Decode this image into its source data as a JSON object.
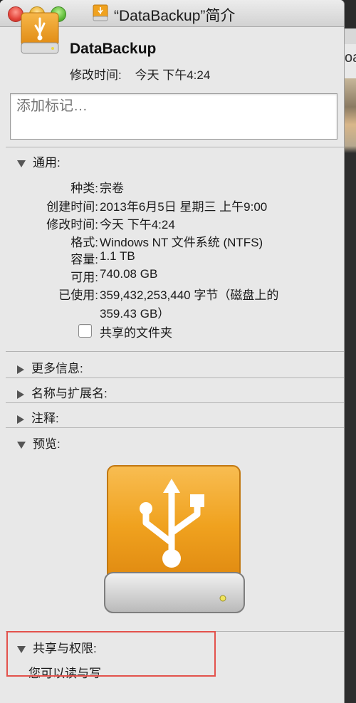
{
  "window": {
    "title": "“DataBackup”简介"
  },
  "background": {
    "partial_text": "oa"
  },
  "header": {
    "name": "DataBackup",
    "modified_label": "修改时间:",
    "modified_value": "今天 下午4:24"
  },
  "tags": {
    "placeholder": "添加标记…"
  },
  "general": {
    "heading": "通用:",
    "rows": [
      {
        "label": "种类:",
        "value": "宗卷"
      },
      {
        "label": "创建时间:",
        "value": "2013年6月5日 星期三 上午9:00"
      },
      {
        "label": "修改时间:",
        "value": "今天 下午4:24"
      },
      {
        "label": "格式:",
        "value": "Windows NT 文件系统 (NTFS)"
      },
      {
        "label": "容量:",
        "value": "1.1 TB"
      },
      {
        "label": "可用:",
        "value": "740.08 GB"
      },
      {
        "label": "已使用:",
        "value": "359,432,253,440 字节（磁盘上的"
      }
    ],
    "used_line2": "359.43 GB）",
    "shared_folder_label": "共享的文件夹",
    "shared_folder_checked": false
  },
  "sections": {
    "more_info": "更多信息:",
    "name_ext": "名称与扩展名:",
    "comments": "注释:",
    "preview": "预览:",
    "sharing": "共享与权限:"
  },
  "permissions": {
    "text": "您可以读与写"
  },
  "colors": {
    "drive_orange": "#f0a21f",
    "highlight_border": "#e3524c"
  }
}
